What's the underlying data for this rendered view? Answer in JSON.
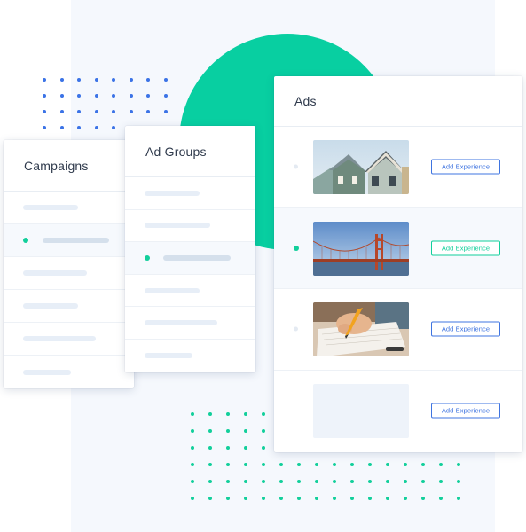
{
  "colors": {
    "accent_green": "#08cfa1",
    "accent_blue": "#3f74e0",
    "panel_bg": "#f5f8fd",
    "text": "#2f3a4c"
  },
  "campaigns": {
    "title": "Campaigns",
    "selected_index": 1,
    "row_count": 6
  },
  "ad_groups": {
    "title": "Ad Groups",
    "selected_index": 2,
    "row_count": 6
  },
  "ads": {
    "title": "Ads",
    "selected_index": 1,
    "items": [
      {
        "image": "victorian-houses-photo",
        "button_label": "Add Experience"
      },
      {
        "image": "golden-gate-bridge-photo",
        "button_label": "Add Experience"
      },
      {
        "image": "hand-writing-photo",
        "button_label": "Add Experience"
      },
      {
        "image": "empty-image-placeholder",
        "button_label": "Add Experience"
      }
    ]
  }
}
